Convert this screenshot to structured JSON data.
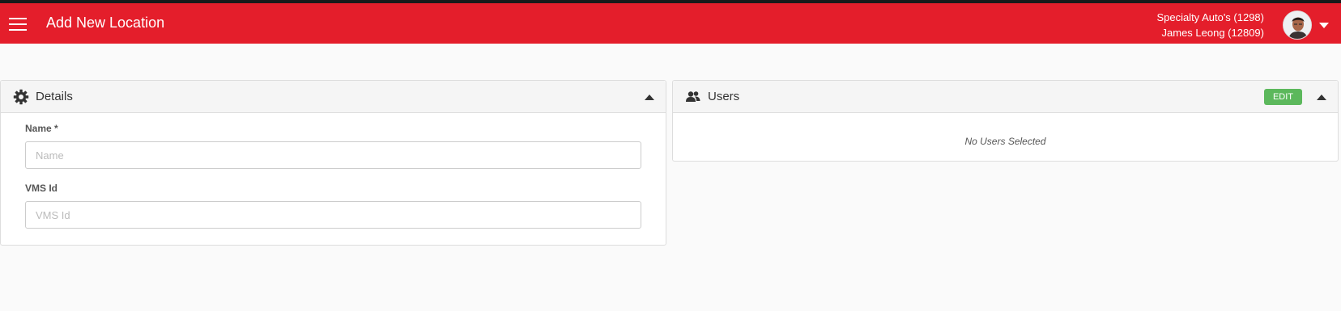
{
  "header": {
    "title": "Add New Location",
    "account_line1": "Specialty Auto's (1298)",
    "account_line2": "James Leong (12809)",
    "brand_color": "#e41e2b"
  },
  "details_panel": {
    "title": "Details",
    "icon": "gear-icon",
    "fields": [
      {
        "label": "Name *",
        "placeholder": "Name",
        "value": ""
      },
      {
        "label": "VMS Id",
        "placeholder": "VMS Id",
        "value": ""
      }
    ]
  },
  "users_panel": {
    "title": "Users",
    "icon": "users-icon",
    "edit_label": "EDIT",
    "edit_color": "#5cb85c",
    "empty_text": "No Users Selected"
  }
}
